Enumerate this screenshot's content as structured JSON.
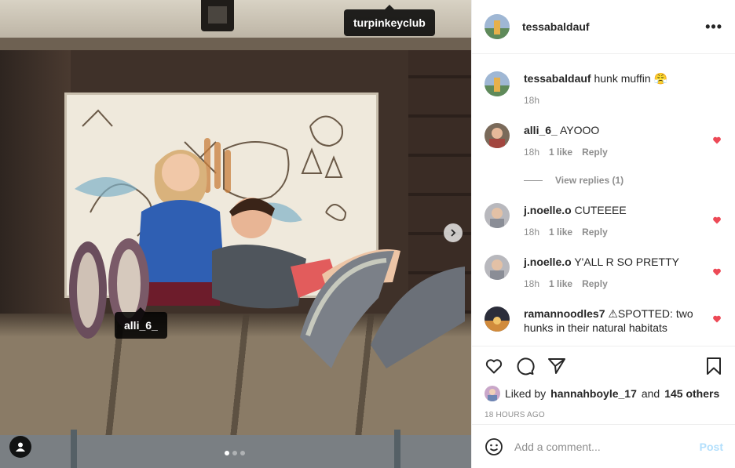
{
  "photo": {
    "tags": [
      "turpinkeyclub",
      "alli_6_"
    ],
    "carousel": {
      "count": 3,
      "active": 0
    }
  },
  "header": {
    "username": "tessabaldauf",
    "more_label": "•••"
  },
  "caption": {
    "username": "tessabaldauf",
    "text": "hunk muffin 😤",
    "time": "18h"
  },
  "comments": [
    {
      "username": "alli_6_",
      "text": "AYOOO",
      "time": "18h",
      "likes": "1 like",
      "reply": "Reply",
      "liked": true
    },
    {
      "username": "j.noelle.o",
      "text": "CUTEEEE",
      "time": "18h",
      "likes": "1 like",
      "reply": "Reply",
      "liked": true
    },
    {
      "username": "j.noelle.o",
      "text": "Y'ALL R SO PRETTY",
      "time": "18h",
      "likes": "1 like",
      "reply": "Reply",
      "liked": true
    },
    {
      "username": "ramannoodles7",
      "text": "⚠SPOTTED: two hunks in their natural habitats",
      "time": "",
      "likes": "",
      "reply": "",
      "liked": true
    }
  ],
  "view_replies": "View replies (1)",
  "likes": {
    "prefix": "Liked by",
    "user": "hannahboyle_17",
    "middle": "and",
    "others": "145 others"
  },
  "posted_time": "18 HOURS AGO",
  "add_comment": {
    "placeholder": "Add a comment...",
    "post_label": "Post"
  },
  "colors": {
    "heart": "#ed4956",
    "post_disabled": "#b2dffc",
    "muted": "#8e8e8e"
  }
}
